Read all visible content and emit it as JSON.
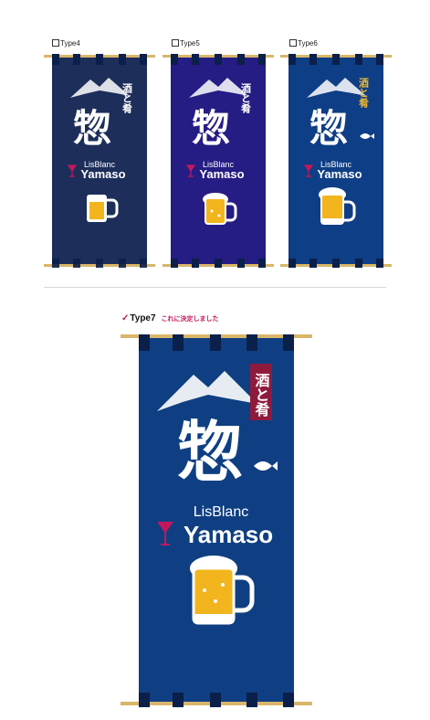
{
  "types": [
    {
      "label": "Type4",
      "bg": "#1d2e5a"
    },
    {
      "label": "Type5",
      "bg": "#251c84"
    },
    {
      "label": "Type6",
      "bg": "#0e3e85"
    }
  ],
  "selected": {
    "label": "Type7",
    "note": "これに決定しました",
    "bg": "#0f3f82",
    "accent": "#c2185b"
  },
  "banner_text": {
    "brand": "LisBlanc",
    "name": "Yamaso",
    "kanji_main": "惣",
    "kanji_side": "酒と肴"
  },
  "colors": {
    "pole": "#d9b66a",
    "tab": "#0a1f4a",
    "sake_tag": "#8e1b3c",
    "sake_gold": "#e8b733",
    "beer": "#f2b51e",
    "wine": "#c2185b"
  }
}
